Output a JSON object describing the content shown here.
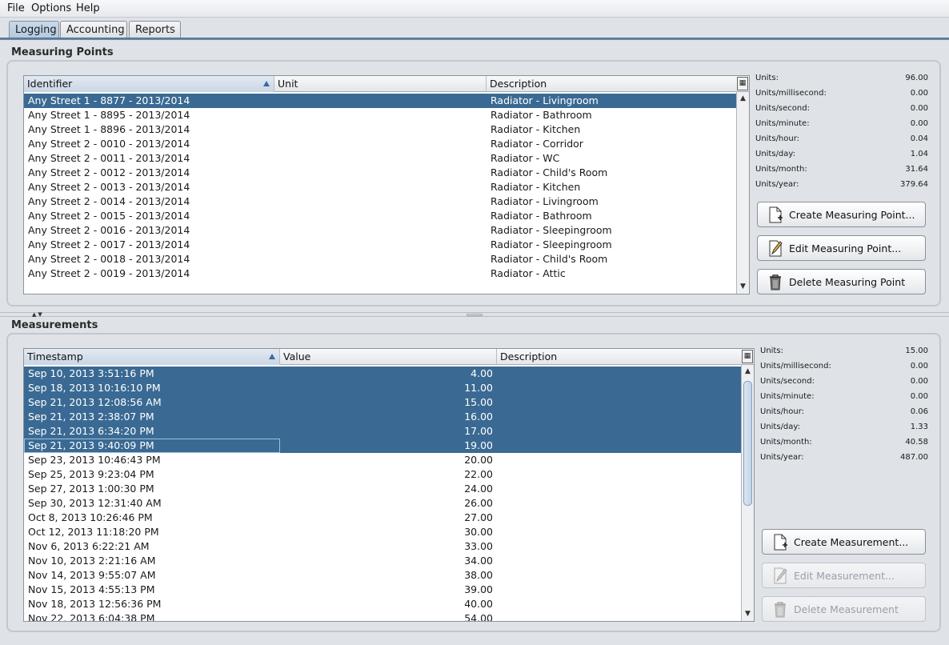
{
  "menu": {
    "file": "File",
    "options": "Options",
    "help": "Help"
  },
  "tabs": [
    "Logging",
    "Accounting",
    "Reports"
  ],
  "colors": {
    "selection": "#3a6a93",
    "accent": "#6a87a6"
  },
  "measuring_points": {
    "title": "Measuring Points",
    "columns": [
      "Identifier",
      "Unit",
      "Description"
    ],
    "rows": [
      {
        "id": "Any Street 1 - 8877 - 2013/2014",
        "unit": "",
        "desc": "Radiator - Livingroom",
        "selected": true
      },
      {
        "id": "Any Street 1 - 8895 - 2013/2014",
        "unit": "",
        "desc": "Radiator - Bathroom",
        "selected": false
      },
      {
        "id": "Any Street 1 - 8896 - 2013/2014",
        "unit": "",
        "desc": "Radiator - Kitchen",
        "selected": false
      },
      {
        "id": "Any Street 2 - 0010 - 2013/2014",
        "unit": "",
        "desc": "Radiator - Corridor",
        "selected": false
      },
      {
        "id": "Any Street 2 - 0011 - 2013/2014",
        "unit": "",
        "desc": "Radiator - WC",
        "selected": false
      },
      {
        "id": "Any Street 2 - 0012 - 2013/2014",
        "unit": "",
        "desc": "Radiator - Child's Room",
        "selected": false
      },
      {
        "id": "Any Street 2 - 0013 - 2013/2014",
        "unit": "",
        "desc": "Radiator - Kitchen",
        "selected": false
      },
      {
        "id": "Any Street 2 - 0014 - 2013/2014",
        "unit": "",
        "desc": "Radiator - Livingroom",
        "selected": false
      },
      {
        "id": "Any Street 2 - 0015 - 2013/2014",
        "unit": "",
        "desc": "Radiator - Bathroom",
        "selected": false
      },
      {
        "id": "Any Street 2 - 0016 - 2013/2014",
        "unit": "",
        "desc": "Radiator - Sleepingroom",
        "selected": false
      },
      {
        "id": "Any Street 2 - 0017 - 2013/2014",
        "unit": "",
        "desc": "Radiator - Sleepingroom",
        "selected": false
      },
      {
        "id": "Any Street 2 - 0018 - 2013/2014",
        "unit": "",
        "desc": "Radiator - Child's Room",
        "selected": false
      },
      {
        "id": "Any Street 2 - 0019 - 2013/2014",
        "unit": "",
        "desc": "Radiator - Attic",
        "selected": false
      }
    ],
    "stats": [
      {
        "label": "Units:",
        "value": "96.00"
      },
      {
        "label": "Units/millisecond:",
        "value": "0.00"
      },
      {
        "label": "Units/second:",
        "value": "0.00"
      },
      {
        "label": "Units/minute:",
        "value": "0.00"
      },
      {
        "label": "Units/hour:",
        "value": "0.04"
      },
      {
        "label": "Units/day:",
        "value": "1.04"
      },
      {
        "label": "Units/month:",
        "value": "31.64"
      },
      {
        "label": "Units/year:",
        "value": "379.64"
      }
    ],
    "buttons": {
      "create": "Create Measuring Point...",
      "edit": "Edit Measuring Point...",
      "delete": "Delete Measuring Point"
    }
  },
  "measurements": {
    "title": "Measurements",
    "columns": [
      "Timestamp",
      "Value",
      "Description"
    ],
    "rows": [
      {
        "ts": "Sep 10, 2013 3:51:16 PM",
        "value": "4.00",
        "desc": "",
        "selected": true
      },
      {
        "ts": "Sep 18, 2013 10:16:10 PM",
        "value": "11.00",
        "desc": "",
        "selected": true
      },
      {
        "ts": "Sep 21, 2013 12:08:56 AM",
        "value": "15.00",
        "desc": "",
        "selected": true
      },
      {
        "ts": "Sep 21, 2013 2:38:07 PM",
        "value": "16.00",
        "desc": "",
        "selected": true
      },
      {
        "ts": "Sep 21, 2013 6:34:20 PM",
        "value": "17.00",
        "desc": "",
        "selected": true
      },
      {
        "ts": "Sep 21, 2013 9:40:09 PM",
        "value": "19.00",
        "desc": "",
        "selected": true
      },
      {
        "ts": "Sep 23, 2013 10:46:43 PM",
        "value": "20.00",
        "desc": "",
        "selected": false
      },
      {
        "ts": "Sep 25, 2013 9:23:04 PM",
        "value": "22.00",
        "desc": "",
        "selected": false
      },
      {
        "ts": "Sep 27, 2013 1:00:30 PM",
        "value": "24.00",
        "desc": "",
        "selected": false
      },
      {
        "ts": "Sep 30, 2013 12:31:40 AM",
        "value": "26.00",
        "desc": "",
        "selected": false
      },
      {
        "ts": "Oct 8, 2013 10:26:46 PM",
        "value": "27.00",
        "desc": "",
        "selected": false
      },
      {
        "ts": "Oct 12, 2013 11:18:20 PM",
        "value": "30.00",
        "desc": "",
        "selected": false
      },
      {
        "ts": "Nov 6, 2013 6:22:21 AM",
        "value": "33.00",
        "desc": "",
        "selected": false
      },
      {
        "ts": "Nov 10, 2013 2:21:16 AM",
        "value": "34.00",
        "desc": "",
        "selected": false
      },
      {
        "ts": "Nov 14, 2013 9:55:07 AM",
        "value": "38.00",
        "desc": "",
        "selected": false
      },
      {
        "ts": "Nov 15, 2013 4:55:13 PM",
        "value": "39.00",
        "desc": "",
        "selected": false
      },
      {
        "ts": "Nov 18, 2013 12:56:36 PM",
        "value": "40.00",
        "desc": "",
        "selected": false
      },
      {
        "ts": "Nov 22, 2013 6:04:38 PM",
        "value": "54.00",
        "desc": "",
        "selected": false
      }
    ],
    "stats": [
      {
        "label": "Units:",
        "value": "15.00"
      },
      {
        "label": "Units/millisecond:",
        "value": "0.00"
      },
      {
        "label": "Units/second:",
        "value": "0.00"
      },
      {
        "label": "Units/minute:",
        "value": "0.00"
      },
      {
        "label": "Units/hour:",
        "value": "0.06"
      },
      {
        "label": "Units/day:",
        "value": "1.33"
      },
      {
        "label": "Units/month:",
        "value": "40.58"
      },
      {
        "label": "Units/year:",
        "value": "487.00"
      }
    ],
    "buttons": {
      "create": "Create Measurement...",
      "edit": "Edit Measurement...",
      "delete": "Delete Measurement"
    }
  }
}
